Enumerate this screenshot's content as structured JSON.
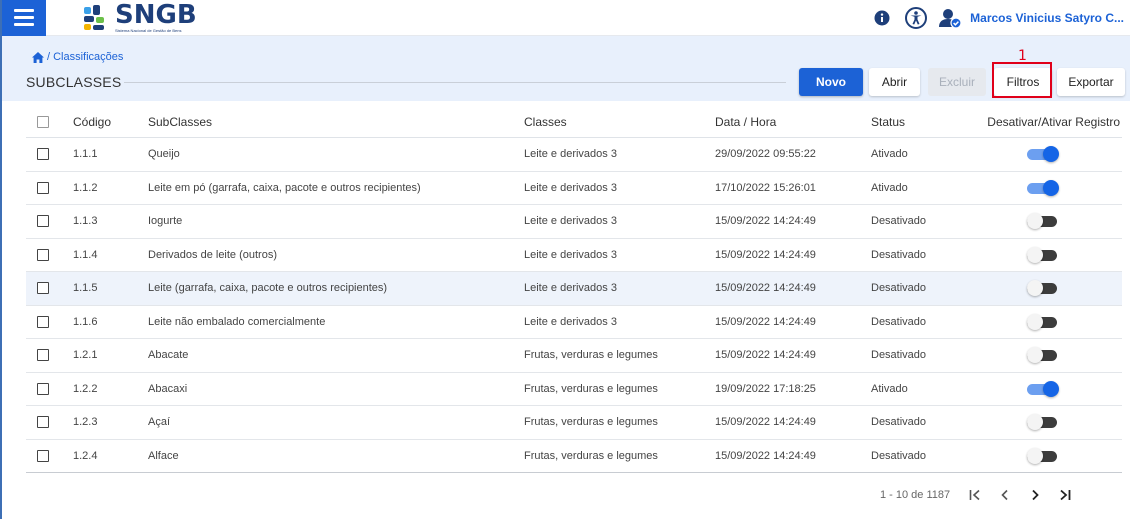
{
  "header": {
    "logo_name": "SNGB",
    "logo_subtitle": "Sistema Nacional de Gestão de Bens",
    "user_name": "Marcos Vinicius Satyro C..."
  },
  "breadcrumb": {
    "label": "/ Classificações"
  },
  "page": {
    "title": "SUBCLASSES"
  },
  "toolbar": {
    "novo_label": "Novo",
    "abrir_label": "Abrir",
    "excluir_label": "Excluir",
    "filtros_label": "Filtros",
    "exportar_label": "Exportar"
  },
  "annotation": {
    "number": "1"
  },
  "table": {
    "columns": {
      "codigo": "Código",
      "subclasses": "SubClasses",
      "classes": "Classes",
      "data_hora": "Data / Hora",
      "status": "Status",
      "toggle": "Desativar/Ativar Registro"
    },
    "rows": [
      {
        "codigo": "1.1.1",
        "subclasse": "Queijo",
        "classe": "Leite e derivados 3",
        "data": "29/09/2022 09:55:22",
        "status": "Ativado",
        "active": true
      },
      {
        "codigo": "1.1.2",
        "subclasse": "Leite em pó (garrafa, caixa, pacote e outros recipientes)",
        "classe": "Leite e derivados 3",
        "data": "17/10/2022 15:26:01",
        "status": "Ativado",
        "active": true
      },
      {
        "codigo": "1.1.3",
        "subclasse": "Iogurte",
        "classe": "Leite e derivados 3",
        "data": "15/09/2022 14:24:49",
        "status": "Desativado",
        "active": false
      },
      {
        "codigo": "1.1.4",
        "subclasse": "Derivados de leite (outros)",
        "classe": "Leite e derivados 3",
        "data": "15/09/2022 14:24:49",
        "status": "Desativado",
        "active": false
      },
      {
        "codigo": "1.1.5",
        "subclasse": "Leite (garrafa, caixa, pacote e outros recipientes)",
        "classe": "Leite e derivados 3",
        "data": "15/09/2022 14:24:49",
        "status": "Desativado",
        "active": false
      },
      {
        "codigo": "1.1.6",
        "subclasse": "Leite não embalado comercialmente",
        "classe": "Leite e derivados 3",
        "data": "15/09/2022 14:24:49",
        "status": "Desativado",
        "active": false
      },
      {
        "codigo": "1.2.1",
        "subclasse": "Abacate",
        "classe": "Frutas, verduras e legumes",
        "data": "15/09/2022 14:24:49",
        "status": "Desativado",
        "active": false
      },
      {
        "codigo": "1.2.2",
        "subclasse": "Abacaxi",
        "classe": "Frutas, verduras e legumes",
        "data": "19/09/2022 17:18:25",
        "status": "Ativado",
        "active": true
      },
      {
        "codigo": "1.2.3",
        "subclasse": "Açaí",
        "classe": "Frutas, verduras e legumes",
        "data": "15/09/2022 14:24:49",
        "status": "Desativado",
        "active": false
      },
      {
        "codigo": "1.2.4",
        "subclasse": "Alface",
        "classe": "Frutas, verduras e legumes",
        "data": "15/09/2022 14:24:49",
        "status": "Desativado",
        "active": false
      }
    ]
  },
  "pagination": {
    "range": "1 - 10 de 1187",
    "first": "|<",
    "prev": "<",
    "next": ">",
    "last": ">|"
  },
  "icons": {
    "menu": "hamburger-icon",
    "info": "info-icon",
    "accessibility": "accessibility-icon",
    "user": "user-check-icon",
    "home": "home-icon"
  },
  "colors": {
    "primary": "#1c62d6",
    "title_bg": "#e8f0fc",
    "annotation": "#e0001a",
    "toggle_on": "#1565e6"
  }
}
